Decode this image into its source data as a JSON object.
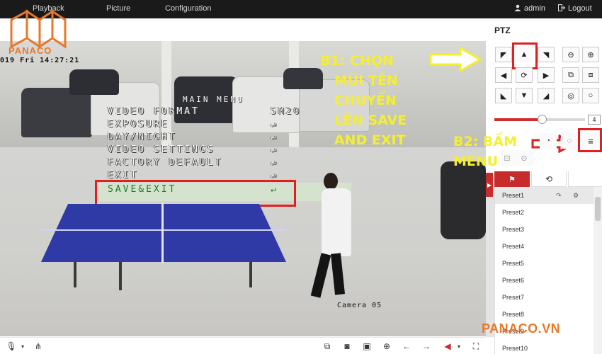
{
  "nav": {
    "tabs": [
      "Playback",
      "Picture",
      "Configuration"
    ],
    "user": "admin",
    "logout": "Logout"
  },
  "logo": {
    "text": "PANACO"
  },
  "video": {
    "timestamp": "019 Fri 14:27:21",
    "camera_label": "Camera 05",
    "osd_menu": {
      "title": "MAIN MENU",
      "items": [
        "VIDEO FORMAT",
        "EXPOSURE",
        "DAY/NIGHT",
        "VIDEO SETTINGS",
        "FACTORY DEFAULT",
        "EXIT",
        "SAVE&EXIT"
      ],
      "video_format_value": "5M20"
    }
  },
  "annotations": {
    "step1": "B1: CHỌN\n   MŨI TÊN\n   CHUYỂN\n   LÊN SAVE\n   AND EXIT",
    "step2": "B2: BẤM\nMENU"
  },
  "ptz": {
    "title": "PTZ",
    "speed_value": "4",
    "speed_fraction": 0.52,
    "presets": [
      "Preset1",
      "Preset2",
      "Preset3",
      "Preset4",
      "Preset5",
      "Preset6",
      "Preset7",
      "Preset8",
      "Preset9",
      "Preset10"
    ]
  },
  "watermark": "PANACO.VN",
  "colors": {
    "accent": "#e01f1f",
    "annotation": "#f6ef2e",
    "brand": "#e8782a",
    "table": "#2f3aa6"
  }
}
